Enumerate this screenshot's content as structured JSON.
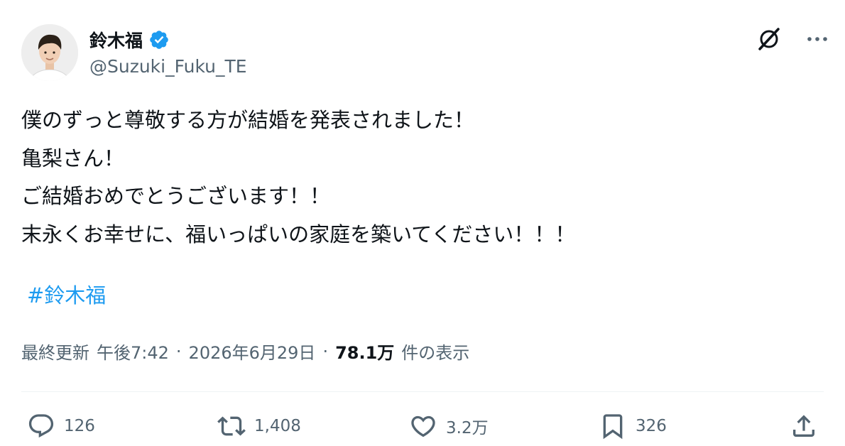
{
  "author": {
    "display_name": "鈴木福",
    "handle": "@Suzuki_Fuku_TE",
    "avatar_icon": "profile-photo",
    "verified_icon": "verified-badge-icon",
    "verified_color": "#1d9bf0"
  },
  "top_actions": {
    "grok_icon": "grok-icon",
    "more_icon": "more-horizontal-icon"
  },
  "tweet": {
    "lines": [
      "僕のずっと尊敬する方が結婚を発表されました！",
      "亀梨さん！",
      "ご結婚おめでとうございます！！",
      "末永くお幸せに、福いっぱいの家庭を築いてください！！！"
    ],
    "hashtag": "#鈴木福"
  },
  "meta": {
    "updated_label": "最終更新",
    "time": "午後7:42",
    "separator": "·",
    "date": "2026年6月29日",
    "views_count": "78.1万",
    "views_label": "件の表示"
  },
  "actions": {
    "replies": "126",
    "reposts": "1,408",
    "likes": "3.2万",
    "bookmarks": "326"
  },
  "colors": {
    "text": "#0f1419",
    "secondary": "#536471",
    "link": "#1d9bf0",
    "divider": "#eff3f4"
  }
}
